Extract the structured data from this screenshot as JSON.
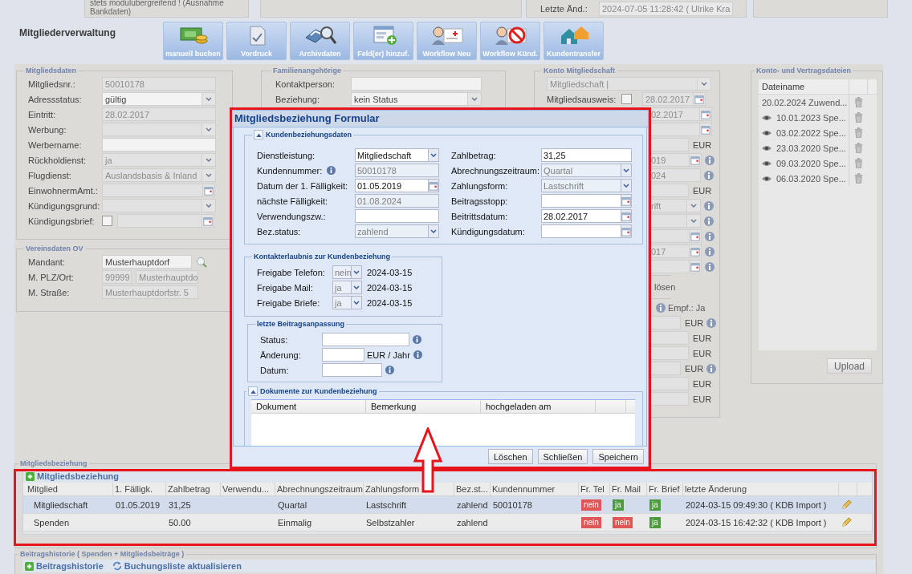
{
  "top_strip": {
    "note": "stets modulübergreifend ! (Ausnahme Bankdaten)",
    "last_change_label": "Letzte Änd.:",
    "last_change": "2024-07-05 11:28:42 ( Ulrike Kra"
  },
  "module_title": "Mitgliederverwaltung",
  "toolbar": [
    {
      "label": "manuell buchen",
      "kind": "money"
    },
    {
      "label": "Vordruck",
      "kind": "form"
    },
    {
      "label": "Archivdaten",
      "kind": "archive"
    },
    {
      "label": "Feld(er) hinzuf.",
      "kind": "fields"
    },
    {
      "label": "Workflow Neu",
      "kind": "workflow_new"
    },
    {
      "label": "Workflow Künd.",
      "kind": "workflow_cancel"
    },
    {
      "label": "Kundentransfer",
      "kind": "transfer"
    }
  ],
  "member_data": {
    "legend": "Mitgliedsdaten",
    "fields": [
      {
        "label": "Mitgliedsnr.:",
        "kind": "text",
        "value": "50010178",
        "disabled": true
      },
      {
        "label": "Adressstatus:",
        "kind": "select",
        "value": "gültig",
        "disabled": false
      },
      {
        "label": "Eintritt:",
        "kind": "text",
        "value": "28.02.2017",
        "disabled": true
      },
      {
        "label": "Werbung:",
        "kind": "select",
        "disabled": true
      },
      {
        "label": "Werbername:",
        "kind": "text",
        "disabled": false
      },
      {
        "label": "Rückholdienst:",
        "kind": "select",
        "value": "ja",
        "disabled": true
      },
      {
        "label": "Flugdienst:",
        "kind": "select",
        "value": "Auslandsbasis & Inland",
        "disabled": true
      },
      {
        "label": "EinwohnermAmt.:",
        "kind": "date",
        "disabled": true
      },
      {
        "label": "Kündigungsgrund:",
        "kind": "select",
        "disabled": true
      },
      {
        "label": "Kündigungsbrief:",
        "kind": "checkdate",
        "checked": false,
        "disabled": true
      }
    ]
  },
  "club_data": {
    "legend": "Vereinsdaten OV",
    "fields": [
      {
        "label": "Mandant:",
        "kind": "search",
        "value": "Musterhauptdorf"
      },
      {
        "label": "M. PLZ/Ort:",
        "kind": "pair",
        "value": "99999",
        "value_2": "Musterhauptdo"
      },
      {
        "label": "M. Straße:",
        "kind": "text",
        "value": "Musterhauptdorfstr. 5"
      }
    ]
  },
  "family": {
    "legend": "Familienangehörige",
    "fields": [
      {
        "label": "Kontaktperson:",
        "kind": "text"
      },
      {
        "label": "Beziehung:",
        "kind": "select",
        "value": "kein Status"
      }
    ]
  },
  "account": {
    "legend": "Konto Mitgliedschaft",
    "selector": "Mitgliedschaft |",
    "card_label": "Mitgliedsausweis:",
    "card_checked": false,
    "card_date": "28.02.2017",
    "rows": [
      {
        "kind": "date",
        "value": "02.2017",
        "info": false
      },
      {
        "kind": "date",
        "info": false
      },
      {
        "kind": "amount",
        "unit": "EUR",
        "info": false
      },
      {
        "kind": "date",
        "value": "019",
        "info": true
      },
      {
        "kind": "text",
        "value": "024",
        "info": true
      },
      {
        "kind": "amount",
        "unit": "EUR",
        "info": false
      },
      {
        "kind": "select",
        "value": "rift",
        "info": true
      },
      {
        "kind": "select",
        "info": true
      },
      {
        "kind": "date",
        "info": true
      },
      {
        "kind": "date",
        "value": "017",
        "info": true
      },
      {
        "kind": "date",
        "info": true
      },
      {
        "kind": "link",
        "value": "lösen"
      },
      {
        "kind": "note",
        "value": "Empf.: Ja"
      },
      {
        "kind": "amount",
        "unit": "EUR",
        "info": true
      },
      {
        "kind": "amount",
        "unit": "EUR",
        "info": false
      },
      {
        "kind": "amount",
        "unit": "EUR",
        "info": false
      },
      {
        "kind": "amount",
        "unit": "EUR",
        "info": true
      },
      {
        "kind": "amount",
        "unit": "EUR",
        "info": false
      },
      {
        "kind": "amount",
        "unit": "EUR",
        "info": false
      }
    ]
  },
  "files": {
    "legend": "Konto- und Vertragsdateien",
    "column": "Dateiname",
    "items": [
      {
        "name": "20.02.2024 Zuwend...",
        "preview": false
      },
      {
        "name": "10.01.2023 Spe...",
        "preview": true
      },
      {
        "name": "03.02.2022 Spe...",
        "preview": true
      },
      {
        "name": "23.03.2020 Spe...",
        "preview": true
      },
      {
        "name": "09.03.2020 Spe...",
        "preview": true
      },
      {
        "name": "06.03.2020 Spe...",
        "preview": true
      }
    ],
    "upload": "Upload"
  },
  "dialog": {
    "title": "Mitgliedsbeziehung Formular",
    "details": {
      "legend": "Kundenbeziehungsdaten",
      "expanded": true,
      "left": [
        {
          "label": "Dienstleistung:",
          "kind": "select",
          "value": "Mitgliedschaft",
          "disabled": false,
          "info": false
        },
        {
          "label": "Kundennummer:",
          "kind": "text",
          "value": "50010178",
          "disabled": true,
          "info": true
        },
        {
          "label": "Datum der 1. Fälligkeit:",
          "kind": "date",
          "value": "01.05.2019",
          "disabled": false,
          "info": false
        },
        {
          "label": "nächste Fälligkeit:",
          "kind": "text",
          "value": "01.08.2024",
          "disabled": true,
          "info": false
        },
        {
          "label": "Verwendungszw.:",
          "kind": "text",
          "disabled": false,
          "info": false
        },
        {
          "label": "Bez.status:",
          "kind": "select",
          "value": "zahlend",
          "disabled": true,
          "info": false
        }
      ],
      "right": [
        {
          "label": "Zahlbetrag:",
          "kind": "text",
          "value": "31,25",
          "disabled": false
        },
        {
          "label": "Abrechnungszeitraum:",
          "kind": "select",
          "value": "Quartal",
          "disabled": true
        },
        {
          "label": "Zahlungsform:",
          "kind": "select",
          "value": "Lastschrift",
          "disabled": true
        },
        {
          "label": "Beitragsstopp:",
          "kind": "date",
          "disabled": false
        },
        {
          "label": "Beitrittsdatum:",
          "kind": "date",
          "value": "28.02.2017",
          "disabled": false
        },
        {
          "label": "Kündigungsdatum:",
          "kind": "date",
          "disabled": false
        }
      ]
    },
    "contact": {
      "legend": "Kontakterlaubnis zur Kundenbeziehung",
      "rows": [
        {
          "label": "Freigabe Telefon:",
          "value": "nein",
          "date": "2024-03-15"
        },
        {
          "label": "Freigabe Mail:",
          "value": "ja",
          "date": "2024-03-15"
        },
        {
          "label": "Freigabe Briefe:",
          "value": "ja",
          "date": "2024-03-15"
        }
      ]
    },
    "adjustment": {
      "legend": "letzte Beitragsanpassung",
      "rows": [
        {
          "label": "Status:",
          "kind": "wide",
          "info": true
        },
        {
          "label": "Änderung:",
          "kind": "amount",
          "unit": "EUR / Jahr",
          "info": true
        },
        {
          "label": "Datum:",
          "kind": "date",
          "info": true
        }
      ]
    },
    "documents": {
      "legend": "Dokumente zur Kundenbeziehung",
      "expanded": true,
      "columns": [
        "Dokument",
        "Bemerkung",
        "hochgeladen am"
      ]
    },
    "buttons": [
      "Löschen",
      "Schließen",
      "Speichern"
    ]
  },
  "relations": {
    "legend": "Mitgliedsbeziehung",
    "title": "Mitgliedsbeziehung",
    "columns": [
      "Mitglied",
      "1. Fälligk.",
      "Zahlbetrag",
      "Verwendu...",
      "Abrechnungszeitraum",
      "Zahlungsform",
      "Bez.st...",
      "Kundennummer",
      "Fr. Tel",
      "Fr. Mail",
      "Fr. Brief",
      "letzte Änderung"
    ],
    "rows": [
      {
        "selected": true,
        "member": "Mitgliedschaft",
        "due": "01.05.2019",
        "amount": "31,25",
        "period": "Quartal",
        "method": "Lastschrift",
        "status": "zahlend",
        "customer": "50010178",
        "flags": [
          {
            "text": "nein",
            "color": "#e05555"
          },
          {
            "text": "ja",
            "color": "#4e9a3e"
          },
          {
            "text": "ja",
            "color": "#4e9a3e"
          }
        ],
        "changed": "2024-03-15 09:49:30 ( KDB Import )"
      },
      {
        "selected": false,
        "member": "Spenden",
        "amount": "50.00",
        "period": "Einmalig",
        "method": "Selbstzahler",
        "status": "zahlend",
        "flags": [
          {
            "text": "nein",
            "color": "#e05555"
          },
          {
            "text": "nein",
            "color": "#e05555"
          },
          {
            "text": "ja",
            "color": "#4e9a3e"
          }
        ],
        "changed": "2024-03-15 16:42:32 ( KDB Import )"
      }
    ]
  },
  "history": {
    "legend": "Beitragshistorie ( Spenden + Mitgliedsbeiträge )",
    "title": "Beitragshistorie",
    "refresh": "Buchungsliste aktualisieren"
  }
}
